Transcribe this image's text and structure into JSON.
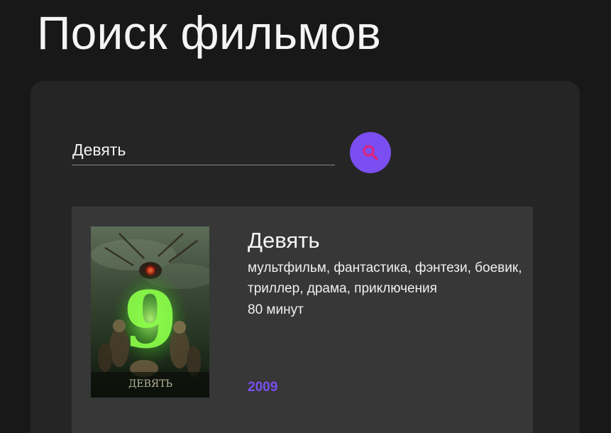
{
  "page": {
    "title": "Поиск фильмов"
  },
  "search": {
    "value": "Девять",
    "button_icon": "search-icon"
  },
  "colors": {
    "accent": "#7a4ef0",
    "background": "#181818",
    "panel": "#252525",
    "card": "#373737"
  },
  "results": [
    {
      "title": "Девять",
      "genres": "мультфильм, фантастика, фэнтези, боевик, триллер, драма, приключения",
      "duration": "80 минут",
      "year": "2009",
      "poster_label": "9",
      "poster_caption": "ДЕВЯТЬ"
    }
  ]
}
